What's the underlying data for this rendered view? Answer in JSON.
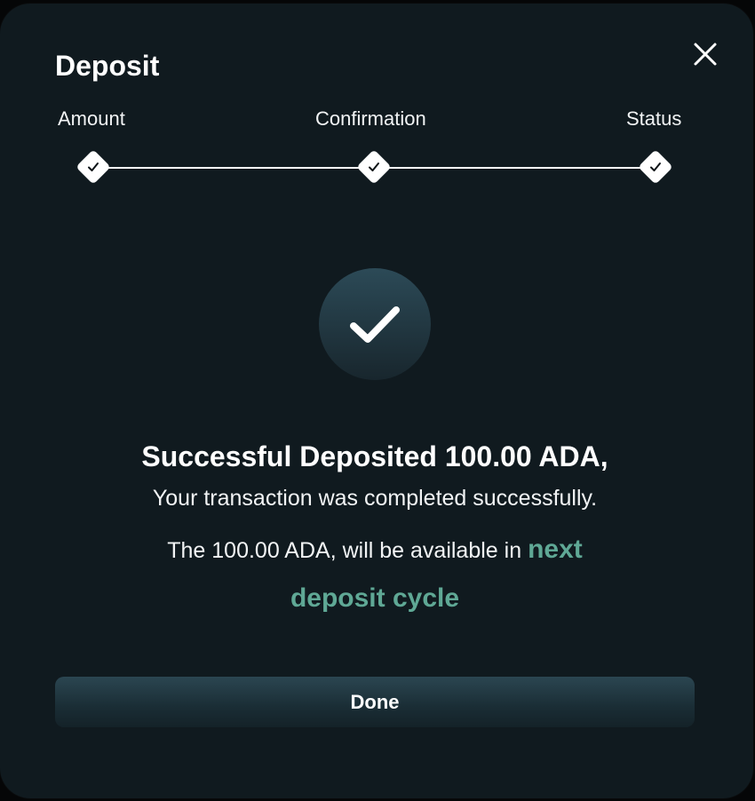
{
  "modal": {
    "title": "Deposit",
    "close_icon": "close-icon"
  },
  "steps": [
    {
      "label": "Amount",
      "state": "completed",
      "icon": "check-icon"
    },
    {
      "label": "Confirmation",
      "state": "completed",
      "icon": "check-icon"
    },
    {
      "label": "Status",
      "state": "completed",
      "icon": "check-icon"
    }
  ],
  "result": {
    "icon": "check-circle-icon",
    "headline": "Successful Deposited 100.00 ADA,",
    "subline": "Your transaction was completed successfully.",
    "availability_prefix": "The 100.00 ADA, will be available in",
    "availability_highlight": "next deposit cycle"
  },
  "actions": {
    "done_label": "Done"
  },
  "colors": {
    "background": "#101a1f",
    "accent": "#5fa895",
    "button": "#1f3640",
    "text": "#ffffff"
  }
}
